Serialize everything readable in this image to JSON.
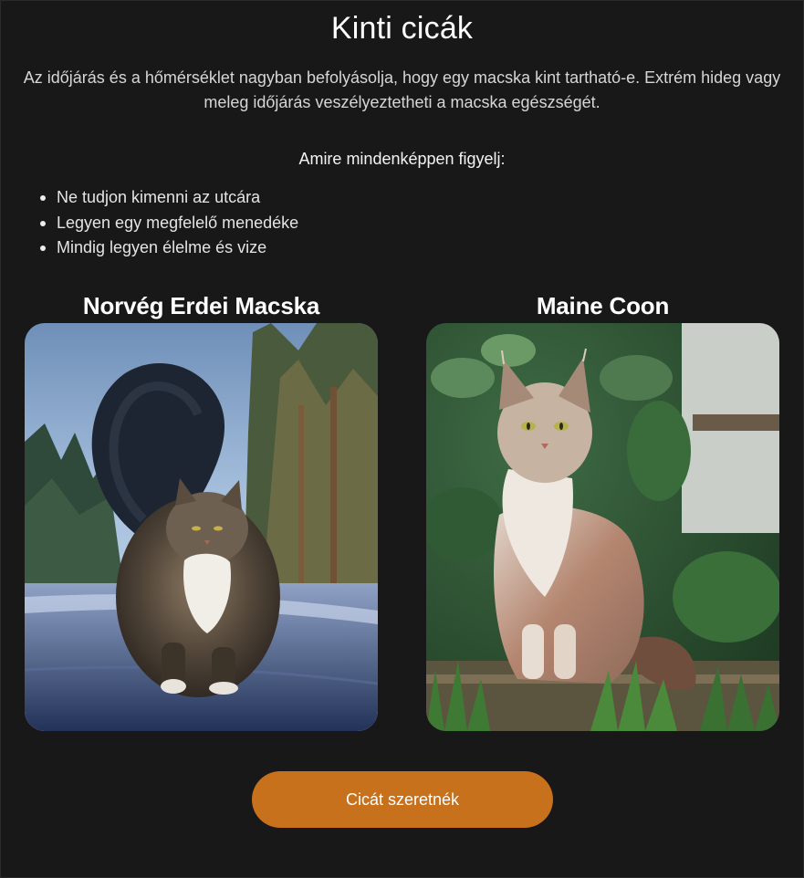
{
  "page": {
    "title": "Kinti cicák",
    "intro": "Az időjárás és a hőmérséklet nagyban befolyásolja, hogy egy macska kint tartható-e. Extrém hideg vagy meleg időjárás veszélyeztetheti a macska egészségét."
  },
  "checklist": {
    "heading": "Amire mindenképpen figyelj:",
    "items": [
      "Ne tudjon kimenni az utcára",
      "Legyen egy megfelelő menedéke",
      "Mindig legyen élelme és vize"
    ]
  },
  "breeds": [
    {
      "name": "Norvég Erdei Macska"
    },
    {
      "name": "Maine Coon"
    }
  ],
  "cta": {
    "label": "Cicát szeretnék"
  },
  "colors": {
    "background": "#181818",
    "accent": "#c8711d",
    "text": "#e9e9e9"
  }
}
